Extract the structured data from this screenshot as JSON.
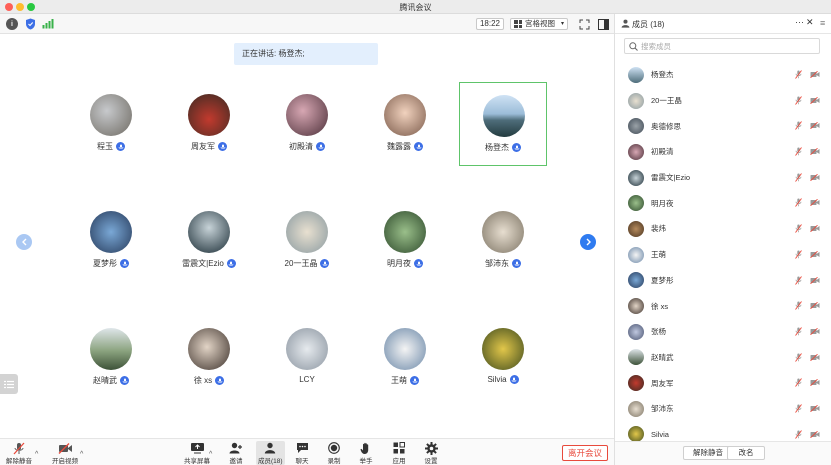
{
  "window": {
    "title": "腾讯会议"
  },
  "topbar": {
    "time": "18:22",
    "view_label": "宫格视图"
  },
  "speaking": {
    "text": "正在讲话: 杨登杰;"
  },
  "colors": {
    "active_border": "#5ec46a",
    "mic_badge": "#3d6fe6",
    "leave_red": "#e84a3c",
    "nav_active": "#2f7bf0",
    "speaking_bg": "#e3effd"
  },
  "grid": [
    {
      "name": "程玉",
      "mic": true,
      "active": false
    },
    {
      "name": "周友军",
      "mic": true,
      "active": false
    },
    {
      "name": "初殿清",
      "mic": true,
      "active": false
    },
    {
      "name": "魏露露",
      "mic": true,
      "active": false
    },
    {
      "name": "杨登杰",
      "mic": true,
      "active": true
    },
    {
      "name": "夏梦彤",
      "mic": true,
      "active": false
    },
    {
      "name": "雷震文|Ezio",
      "mic": true,
      "active": false
    },
    {
      "name": "20一王晶",
      "mic": true,
      "active": false
    },
    {
      "name": "明月夜",
      "mic": true,
      "active": false
    },
    {
      "name": "邹沛东",
      "mic": true,
      "active": false
    },
    {
      "name": "赵晴武",
      "mic": true,
      "active": false
    },
    {
      "name": "徐 xs",
      "mic": true,
      "active": false
    },
    {
      "name": "LCY",
      "mic": false,
      "active": false
    },
    {
      "name": "王萌",
      "mic": true,
      "active": false
    },
    {
      "name": "Silvia",
      "mic": true,
      "active": false
    }
  ],
  "toolbar": {
    "unmute": "解除静音",
    "video": "开启视频",
    "share": "共享屏幕",
    "invite": "邀请",
    "members": "成员(18)",
    "chat": "聊天",
    "record": "录制",
    "raise_hand": "举手",
    "apps": "应用",
    "settings": "设置",
    "leave": "离开会议"
  },
  "panel": {
    "title": "成员 (18)",
    "search_placeholder": "搜索成员",
    "members": [
      "杨登杰",
      "20一王晶",
      "奥德修思",
      "初殿清",
      "雷震文|Ezio",
      "明月夜",
      "裴炜",
      "王萌",
      "夏梦彤",
      "徐 xs",
      "张杨",
      "赵晴武",
      "周友军",
      "邹沛东",
      "Silvia"
    ],
    "unmute_all": "解除静音",
    "rename": "改名"
  }
}
